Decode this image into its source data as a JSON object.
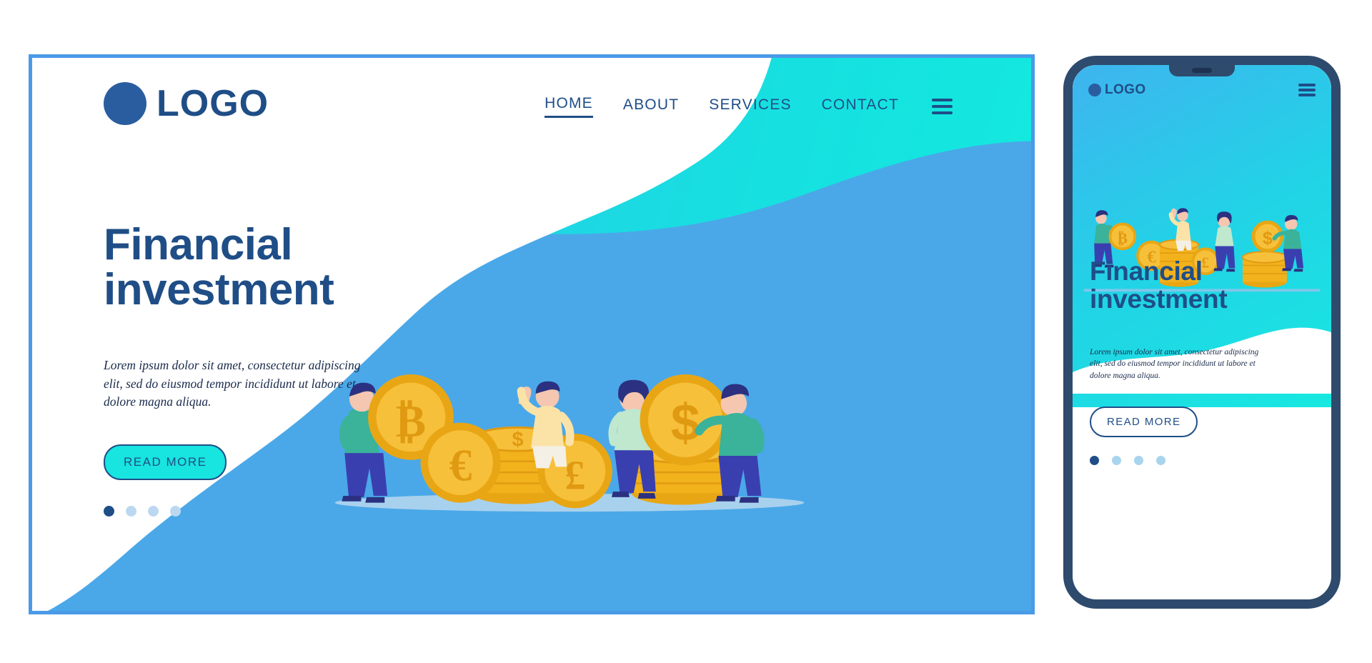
{
  "meta": {
    "kind": "landing-page-mockup",
    "colors": {
      "brand_blue": "#1f4e87",
      "frame_blue": "#4a9ae8",
      "cyan": "#15ecdf",
      "teal_mid": "#22d2e6",
      "sky_blue": "#3fb4ef",
      "coin_gold": "#f2b21c",
      "coin_gold_dark": "#e09a12",
      "white": "#ffffff",
      "phone_bezel": "#2e4a6d"
    }
  },
  "desktop": {
    "logo": {
      "text": "LOGO",
      "icon": "circle-logo-icon"
    },
    "nav": {
      "items": [
        {
          "label": "HOME",
          "active": true
        },
        {
          "label": "ABOUT",
          "active": false
        },
        {
          "label": "SERVICES",
          "active": false
        },
        {
          "label": "CONTACT",
          "active": false
        }
      ],
      "menu_icon": "hamburger-menu-icon"
    },
    "hero": {
      "title_line1": "Financial",
      "title_line2": "investment",
      "paragraph": "Lorem ipsum dolor sit amet, consectetur adipiscing elit, sed do eiusmod tempor incididunt ut labore et dolore magna aliqua.",
      "cta_label": "READ MORE",
      "carousel": {
        "total": 4,
        "active_index": 0
      }
    },
    "illustration": {
      "name": "financial-investment-illustration",
      "coins": [
        {
          "symbol": "₿",
          "name": "bitcoin-coin",
          "label": "Bitcoin"
        },
        {
          "symbol": "€",
          "name": "euro-coin",
          "label": "Euro"
        },
        {
          "symbol": "£",
          "name": "pound-coin",
          "label": "Pound"
        },
        {
          "symbol": "$",
          "name": "dollar-coin",
          "label": "Dollar"
        }
      ],
      "people": [
        {
          "name": "person-holding-bitcoin"
        },
        {
          "name": "person-cheering-on-coin-stack"
        },
        {
          "name": "woman-standing"
        },
        {
          "name": "person-holding-dollar-coin"
        }
      ]
    }
  },
  "phone": {
    "logo": {
      "text": "LOGO",
      "icon": "circle-logo-icon"
    },
    "nav": {
      "menu_icon": "hamburger-menu-icon"
    },
    "hero": {
      "title_line1": "Financial",
      "title_line2": "investment",
      "paragraph": "Lorem ipsum dolor sit amet, consectetur adipiscing elit, sed do eiusmod tempor incididunt ut labore et dolore magna aliqua.",
      "cta_label": "READ MORE",
      "carousel": {
        "total": 4,
        "active_index": 0
      }
    },
    "illustration": {
      "name": "financial-investment-illustration-mobile",
      "coins": [
        {
          "symbol": "₿",
          "name": "bitcoin-coin"
        },
        {
          "symbol": "€",
          "name": "euro-coin"
        },
        {
          "symbol": "£",
          "name": "pound-coin"
        },
        {
          "symbol": "$",
          "name": "dollar-coin"
        }
      ]
    }
  }
}
